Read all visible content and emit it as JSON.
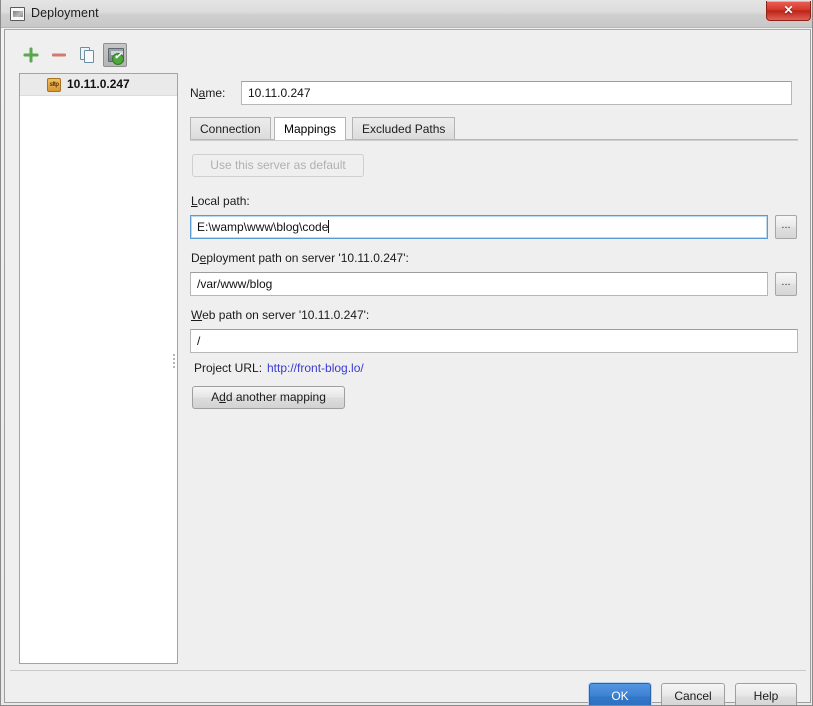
{
  "window": {
    "title": "Deployment",
    "title_icon": "window-image-icon",
    "close_label": "✕"
  },
  "left_panel": {
    "toolbar": [
      {
        "name": "add-server-button",
        "icon": "plus-icon",
        "tooltip": "Add"
      },
      {
        "name": "remove-server-button",
        "icon": "minus-icon",
        "tooltip": "Remove"
      },
      {
        "name": "copy-server-button",
        "icon": "copy-icon",
        "tooltip": "Copy"
      },
      {
        "name": "set-default-button",
        "icon": "server-check-icon",
        "tooltip": "Use as default",
        "pressed": true
      }
    ],
    "servers": [
      {
        "label": "10.11.0.247",
        "icon": "sftp-icon",
        "selected": true
      }
    ]
  },
  "form": {
    "name_label": "Name:",
    "name_mnemonic": "a",
    "name_value": "10.11.0.247"
  },
  "tabs": [
    {
      "label": "Connection",
      "active": false
    },
    {
      "label": "Mappings",
      "active": true
    },
    {
      "label": "Excluded Paths",
      "active": false
    }
  ],
  "mappings": {
    "use_default_button": "Use this server as default",
    "use_default_disabled": true,
    "local_path_label": "Local path:",
    "local_path_mnemonic": "L",
    "local_path_value": "E:\\wamp\\www\\blog\\code",
    "local_path_focused": true,
    "deployment_path_label": "Deployment path on server '10.11.0.247':",
    "deployment_path_mnemonic": "e",
    "deployment_path_value": "/var/www/blog",
    "web_path_label": "Web path on server '10.11.0.247':",
    "web_path_mnemonic": "W",
    "web_path_value": "/",
    "browse_label": "...",
    "project_url_label": "Project URL:",
    "project_url_value": "http://front-blog.lo/",
    "add_mapping_button": "Add another mapping"
  },
  "footer": {
    "ok": "OK",
    "cancel": "Cancel",
    "help": "Help"
  },
  "colors": {
    "accent": "#3d81d2",
    "link": "#3a3ad6",
    "close": "#d43a2d",
    "add": "#5aa74f",
    "remove": "#d4796f"
  }
}
